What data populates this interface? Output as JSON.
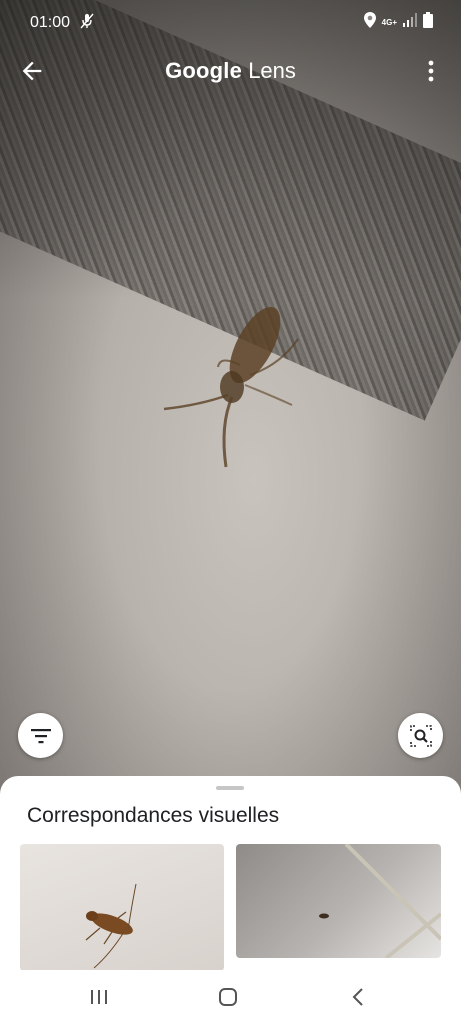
{
  "status_bar": {
    "time": "01:00",
    "network": "4G+",
    "icons": [
      "mic-off-icon",
      "location-icon",
      "signal-icon",
      "battery-icon"
    ]
  },
  "app": {
    "title_brand": "Google",
    "title_product": "Lens"
  },
  "icons": {
    "back": "arrow-left-icon",
    "more": "more-vertical-icon",
    "filter": "filter-icon",
    "search_region": "image-search-icon"
  },
  "results": {
    "section_title": "Correspondances visuelles",
    "thumbnails": [
      {
        "name": "visual-match-1"
      },
      {
        "name": "visual-match-2"
      }
    ]
  },
  "navigation": {
    "items": [
      "recents",
      "home",
      "back"
    ]
  },
  "colors": {
    "sheet_bg": "#ffffff",
    "text_primary": "#202124",
    "overlay_text": "#ffffff"
  }
}
